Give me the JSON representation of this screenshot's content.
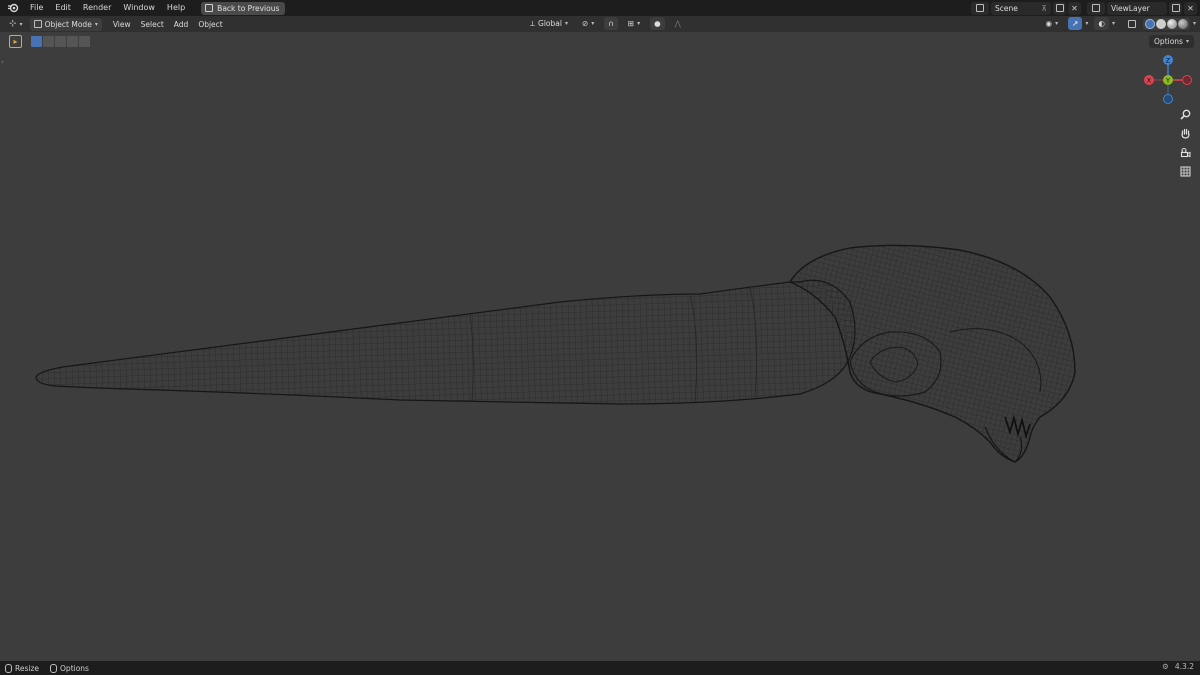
{
  "topbar": {
    "menu": [
      "File",
      "Edit",
      "Render",
      "Window",
      "Help"
    ],
    "back_button": "Back to Previous",
    "scene_name": "Scene",
    "view_layer": "ViewLayer"
  },
  "header": {
    "mode": "Object Mode",
    "menus": [
      "View",
      "Select",
      "Add",
      "Object"
    ],
    "transform_orientation": "Global",
    "options_label": "Options"
  },
  "gizmo": {
    "axes": {
      "x": "X",
      "y": "Y",
      "z": "Z"
    },
    "colors": {
      "x": "#e0414f",
      "y": "#8bbd1f",
      "z": "#3f84d6"
    }
  },
  "navigation": {
    "icons": [
      "zoom-icon",
      "pan-hand-icon",
      "camera-icon",
      "grid-icon"
    ]
  },
  "statusbar": {
    "resize": "Resize",
    "options": "Options",
    "version": "4.3.2"
  },
  "colors": {
    "viewport_bg": "#3d3d3d",
    "active_tool": "#e6a33e",
    "selection_accent": "#4772b3"
  }
}
